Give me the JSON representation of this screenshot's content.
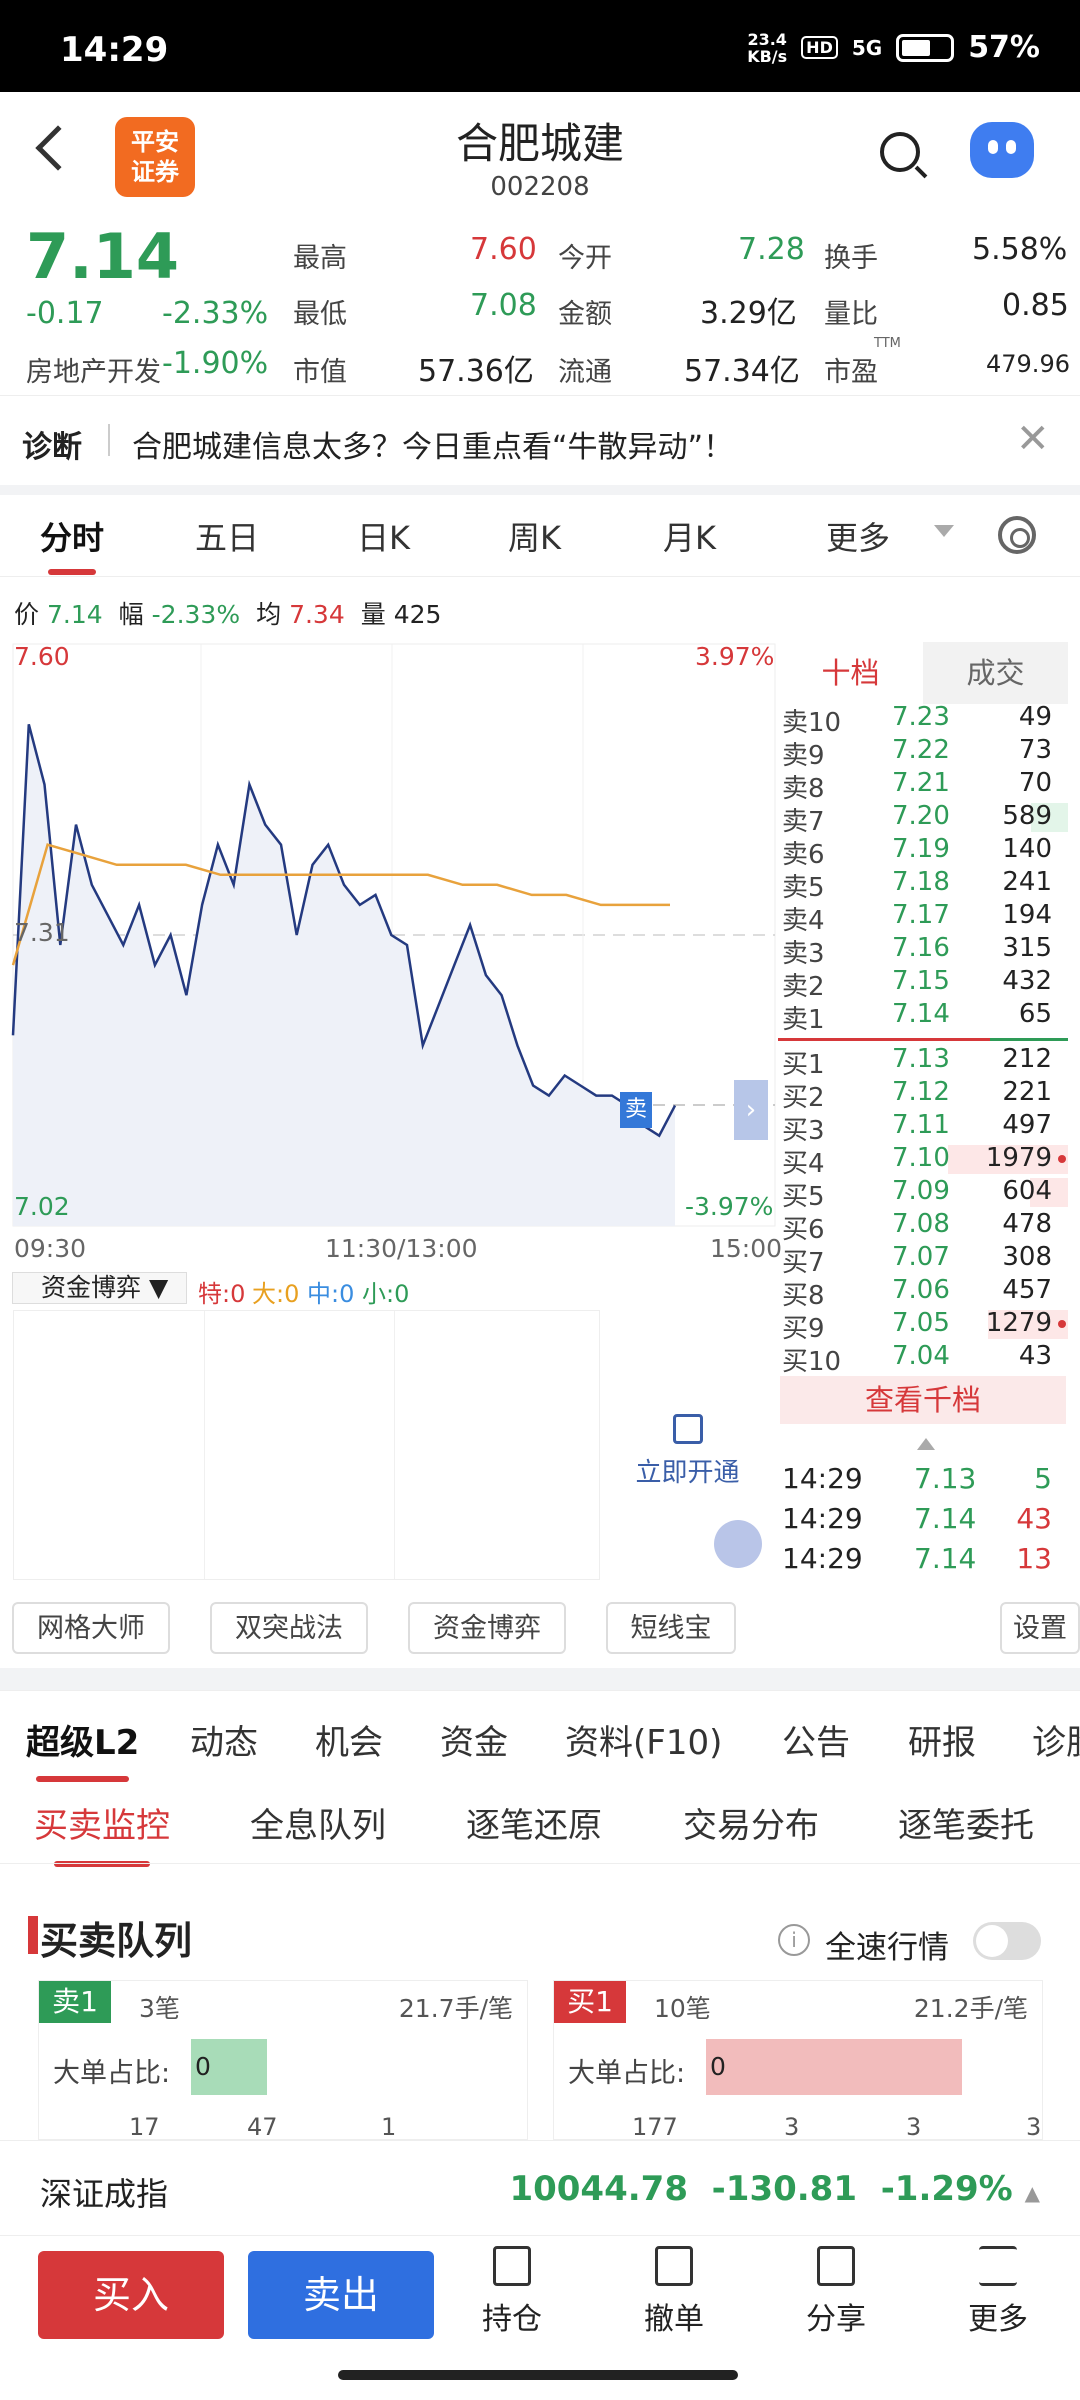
{
  "status": {
    "time": "14:29",
    "net_speed_top": "23.4",
    "net_speed_unit": "KB/s",
    "hd": "HD",
    "network": "5G",
    "battery": "57%"
  },
  "header": {
    "logo_line1": "平安",
    "logo_line2": "证券",
    "title": "合肥城建",
    "code": "002208"
  },
  "quote": {
    "price": "7.14",
    "change": "-0.17",
    "change_pct": "-2.33%",
    "sector": "房地产开发",
    "sector_pct": "-1.90%",
    "high_label": "最高",
    "high": "7.60",
    "low_label": "最低",
    "low": "7.08",
    "mcap_label": "市值",
    "mcap": "57.36亿",
    "open_label": "今开",
    "open": "7.28",
    "amount_label": "金额",
    "amount": "3.29亿",
    "float_label": "流通",
    "float": "57.34亿",
    "turnover_label": "换手",
    "turnover": "5.58%",
    "ratio_label": "量比",
    "ratio": "0.85",
    "pe_label": "市盈",
    "pe_sup": "TTM",
    "pe": "479.96"
  },
  "diagnose": {
    "label": "诊断",
    "text": "合肥城建信息太多？今日重点看“牛散异动”！"
  },
  "period_tabs": [
    "分时",
    "五日",
    "日K",
    "周K",
    "月K",
    "更多"
  ],
  "info_line": {
    "p_label": "价",
    "p": "7.14",
    "f_label": "幅",
    "f": "-2.33%",
    "a_label": "均",
    "a": "7.34",
    "v_label": "量",
    "v": "425"
  },
  "chart_data": {
    "type": "line",
    "x_labels": [
      "09:30",
      "11:30/13:00",
      "15:00"
    ],
    "y_max": "7.60",
    "y_mid": "7.31",
    "y_min": "7.02",
    "pct_max": "3.97%",
    "pct_min": "-3.97%",
    "ylim": [
      7.02,
      7.6
    ],
    "series": [
      {
        "values": [
          7.21,
          7.52,
          7.46,
          7.3,
          7.42,
          7.36,
          7.33,
          7.3,
          7.34,
          7.28,
          7.31,
          7.25,
          7.34,
          7.4,
          7.36,
          7.46,
          7.42,
          7.4,
          7.31,
          7.38,
          7.4,
          7.36,
          7.34,
          7.35,
          7.31,
          7.3,
          7.2,
          7.24,
          7.28,
          7.32,
          7.27,
          7.25,
          7.2,
          7.16,
          7.15,
          7.17,
          7.16,
          7.15,
          7.15,
          7.14,
          7.12,
          7.11,
          7.14
        ]
      },
      {
        "values": [
          7.28,
          7.4,
          7.39,
          7.38,
          7.38,
          7.38,
          7.37,
          7.37,
          7.37,
          7.37,
          7.37,
          7.37,
          7.37,
          7.36,
          7.36,
          7.35,
          7.35,
          7.34,
          7.34,
          7.34
        ]
      }
    ],
    "marker": "卖"
  },
  "book": {
    "tab_active": "十档",
    "tab_other": "成交",
    "asks": [
      {
        "n": "卖10",
        "p": "7.23",
        "v": "49"
      },
      {
        "n": "卖9",
        "p": "7.22",
        "v": "73"
      },
      {
        "n": "卖8",
        "p": "7.21",
        "v": "70"
      },
      {
        "n": "卖7",
        "p": "7.20",
        "v": "589"
      },
      {
        "n": "卖6",
        "p": "7.19",
        "v": "140"
      },
      {
        "n": "卖5",
        "p": "7.18",
        "v": "241"
      },
      {
        "n": "卖4",
        "p": "7.17",
        "v": "194"
      },
      {
        "n": "卖3",
        "p": "7.16",
        "v": "315"
      },
      {
        "n": "卖2",
        "p": "7.15",
        "v": "432"
      },
      {
        "n": "卖1",
        "p": "7.14",
        "v": "65"
      }
    ],
    "bids": [
      {
        "n": "买1",
        "p": "7.13",
        "v": "212"
      },
      {
        "n": "买2",
        "p": "7.12",
        "v": "221"
      },
      {
        "n": "买3",
        "p": "7.11",
        "v": "497"
      },
      {
        "n": "买4",
        "p": "7.10",
        "v": "1979"
      },
      {
        "n": "买5",
        "p": "7.09",
        "v": "604"
      },
      {
        "n": "买6",
        "p": "7.08",
        "v": "478"
      },
      {
        "n": "买7",
        "p": "7.07",
        "v": "308"
      },
      {
        "n": "买8",
        "p": "7.06",
        "v": "457"
      },
      {
        "n": "买9",
        "p": "7.05",
        "v": "1279"
      },
      {
        "n": "买10",
        "p": "7.04",
        "v": "43"
      }
    ],
    "view_all": "查看千档",
    "ticks": [
      {
        "t": "14:29",
        "p": "7.13",
        "v": "5"
      },
      {
        "t": "14:29",
        "p": "7.14",
        "v": "43"
      },
      {
        "t": "14:29",
        "p": "7.14",
        "v": "13"
      }
    ]
  },
  "fund": {
    "label": "资金博弈",
    "s_label": "特:",
    "s": "0",
    "b_label": "大:",
    "b": "0",
    "m_label": "中:",
    "m": "0",
    "x_label": "小:",
    "x": "0",
    "unlock": "立即开通"
  },
  "tools": [
    "网格大师",
    "双突战法",
    "资金博弈",
    "短线宝",
    "设置"
  ],
  "tabs1": [
    "超级L2",
    "动态",
    "机会",
    "资金",
    "资料(F10)",
    "公告",
    "研报",
    "诊股"
  ],
  "tabs2": [
    "买卖监控",
    "全息队列",
    "逐笔还原",
    "交易分布",
    "逐笔委托"
  ],
  "queue": {
    "title": "买卖队列",
    "fullspeed": "全速行情",
    "left": {
      "tag": "卖1",
      "count": "3笔",
      "avg": "21.7手/笔",
      "ratio_label": "大单占比:",
      "ratio": "0",
      "nums": [
        "17",
        "47",
        "1"
      ]
    },
    "right": {
      "tag": "买1",
      "count": "10笔",
      "avg": "21.2手/笔",
      "ratio_label": "大单占比:",
      "ratio": "0",
      "nums": [
        "177",
        "3",
        "3",
        "3"
      ]
    }
  },
  "index": {
    "name": "深证成指",
    "value": "10044.78",
    "change": "-130.81",
    "pct": "-1.29%"
  },
  "actions": {
    "buy": "买入",
    "sell": "卖出",
    "hold": "持仓",
    "cancel": "撤单",
    "share": "分享",
    "more": "更多"
  }
}
